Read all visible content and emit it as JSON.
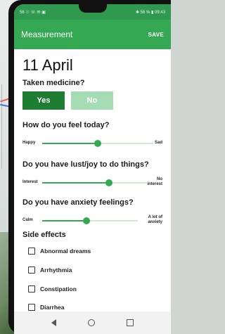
{
  "app": {
    "title": "Measurement",
    "save_label": "SAVE",
    "accent": "#34a853",
    "accent_dark": "#1e7d33",
    "accent_light": "#a6dcb3"
  },
  "statusbar": {
    "left": "56 ☉ ☏ ✉ ▣",
    "right": "✱ 56 % ▮ 09:43"
  },
  "date": "11 April",
  "medicine": {
    "question": "Taken medicine?",
    "yes_label": "Yes",
    "no_label": "No",
    "selected": "Yes"
  },
  "feel": {
    "question": "How do you feel today?",
    "left_label": "Happy",
    "right_label": "Sad",
    "level": 0.5
  },
  "lust": {
    "question": "Do you have lust/joy to do things?",
    "left_label": "Interest",
    "right_label_line1": "No",
    "right_label_line2": "interest",
    "level": 0.63
  },
  "anxiety": {
    "question": "Do you have anxiety feelings?",
    "left_label": "Calm",
    "right_label_line1": "A lot of",
    "right_label_line2": "anxiety",
    "level": 0.46
  },
  "side_effects": {
    "title": "Side effects",
    "items": [
      {
        "label": "Abnormal dreams",
        "checked": false
      },
      {
        "label": "Arrhythmia",
        "checked": false
      },
      {
        "label": "Constipation",
        "checked": false
      },
      {
        "label": "Diarrhea",
        "checked": false
      }
    ]
  }
}
